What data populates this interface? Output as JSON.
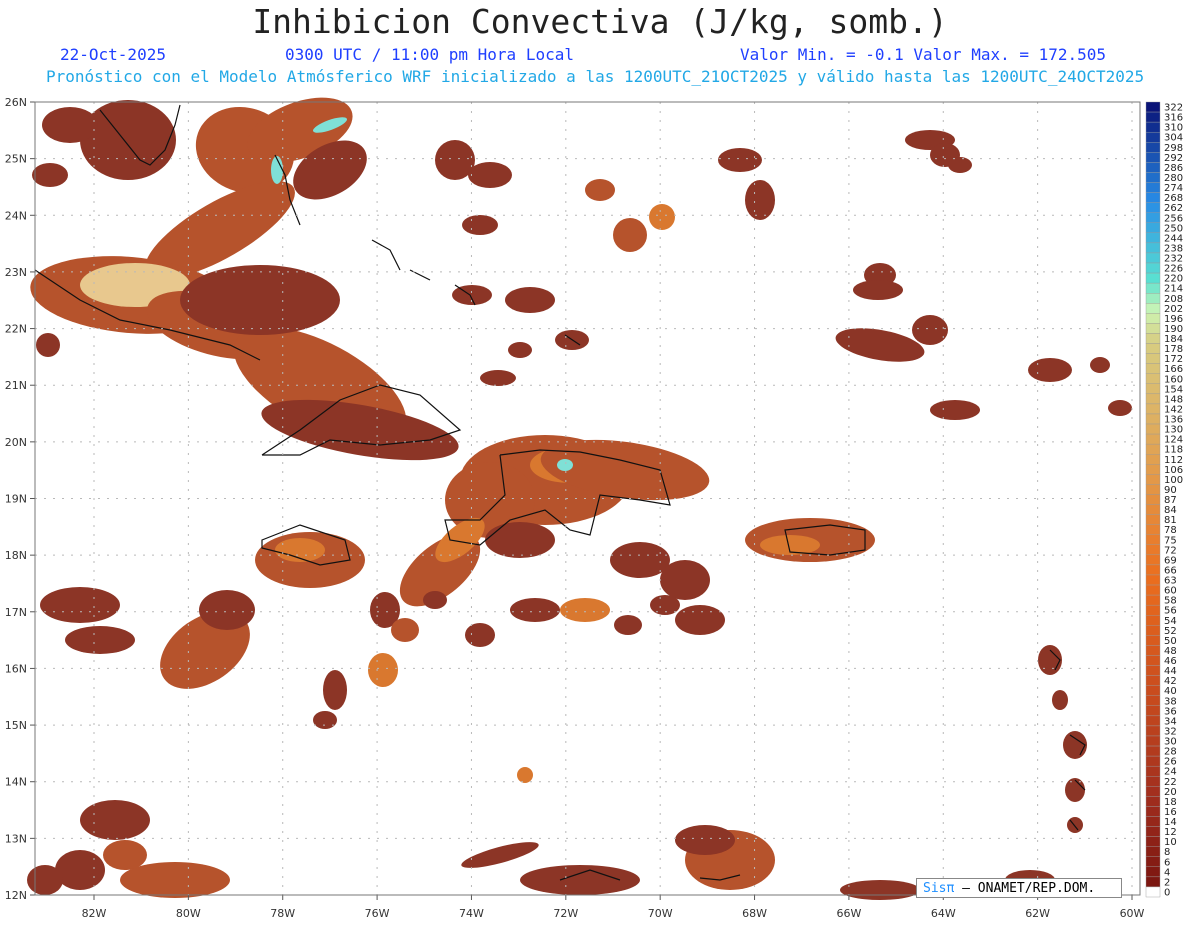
{
  "header": {
    "title": "Inhibicion Convectiva (J/kg, somb.)",
    "date": "22-Oct-2025",
    "time": "0300 UTC / 11:00 pm Hora Local",
    "minmax": "Valor Min. = -0.1  Valor Max. = 172.505",
    "model_line": "Pronóstico con el Modelo Atmósferico WRF inicializado a las 1200UTC_21OCT2025 y válido hasta las  1200UTC_24OCT2025"
  },
  "map": {
    "lat_labels": [
      "26N",
      "25N",
      "24N",
      "23N",
      "22N",
      "21N",
      "20N",
      "19N",
      "18N",
      "17N",
      "16N",
      "15N",
      "14N",
      "13N",
      "12N"
    ],
    "lon_labels": [
      "82W",
      "80W",
      "78W",
      "76W",
      "74W",
      "72W",
      "70W",
      "68W",
      "66W",
      "64W",
      "62W",
      "60W"
    ],
    "colors": {
      "dark": "#8c3526",
      "mid": "#b6532c",
      "orange": "#d9782f",
      "light": "#e8c88e",
      "cyan": "#7fe0d6",
      "coast": "#111111",
      "grid": "#b9b9b9"
    }
  },
  "colorbar": {
    "labels": [
      "322",
      "316",
      "310",
      "304",
      "298",
      "292",
      "286",
      "280",
      "274",
      "268",
      "262",
      "256",
      "250",
      "244",
      "238",
      "232",
      "226",
      "220",
      "214",
      "208",
      "202",
      "196",
      "190",
      "184",
      "178",
      "172",
      "166",
      "160",
      "154",
      "148",
      "142",
      "136",
      "130",
      "124",
      "118",
      "112",
      "106",
      "100",
      "90",
      "87",
      "84",
      "81",
      "78",
      "75",
      "72",
      "69",
      "66",
      "63",
      "60",
      "58",
      "56",
      "54",
      "52",
      "50",
      "48",
      "46",
      "44",
      "42",
      "40",
      "38",
      "36",
      "34",
      "32",
      "30",
      "28",
      "26",
      "24",
      "22",
      "20",
      "18",
      "16",
      "14",
      "12",
      "10",
      "8",
      "6",
      "4",
      "2",
      "0"
    ]
  },
  "credit": {
    "sis": "Sisπ",
    "rest": "– ONAMET/REP.DOM."
  }
}
